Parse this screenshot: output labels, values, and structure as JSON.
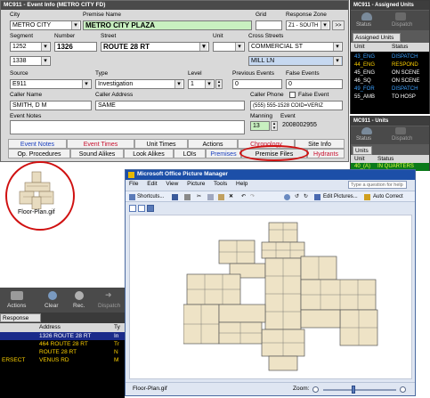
{
  "event_info": {
    "title": "MC911 - Event Info (METRO CITY FD)",
    "labels": {
      "city": "City",
      "premise_name": "Premise Name",
      "grid": "Grid",
      "response_zone": "Response Zone",
      "segment": "Segment",
      "number": "Number",
      "street": "Street",
      "unit": "Unit",
      "cross_streets": "Cross Streets",
      "source": "Source",
      "type": "Type",
      "level": "Level",
      "previous_events": "Previous Events",
      "false_events": "False Events",
      "caller_name": "Caller Name",
      "caller_address": "Caller Address",
      "caller_phone": "Caller Phone",
      "false_event": "False Event",
      "event_notes": "Event Notes",
      "manning": "Manning",
      "event": "Event"
    },
    "values": {
      "city": "METRO CITY",
      "premise_name": "METRO CITY PLAZA",
      "response_zone": "Z1 - SOUTH",
      "segment": "1252",
      "segment2": "1338",
      "number": "1326",
      "street": "ROUTE 28 RT",
      "cross_street_1": "COMMERCIAL ST",
      "cross_street_2": "MILL LN",
      "source": "E911",
      "type": "Investigation",
      "level": "1",
      "previous_events": "0",
      "false_events": "0",
      "caller_name": "SMITH, D M",
      "caller_address": "SAME",
      "caller_phone": "(555) 555-1528 COID=VERIZ",
      "manning": "13",
      "event_number": "2008002955",
      "zone_btn": ">>"
    },
    "tabs_row1": [
      "Event Notes",
      "Event Times",
      "Unit Times",
      "Actions",
      "Chronology",
      "Site Info"
    ],
    "tabs_row2": [
      "Op. Procedures",
      "Sound Alikes",
      "Look Alikes",
      "LOIs",
      "Premises",
      "Premise Files",
      "Hydrants"
    ],
    "colors": {
      "event_notes": "#1a3fbf",
      "event_times": "#c8102e",
      "chronology": "#c8102e",
      "premises": "#1a3fbf",
      "hydrants": "#c8102e"
    }
  },
  "assigned_units": {
    "title": "MC911 - Assigned Units",
    "buttons": [
      "Status",
      "Dispatch"
    ],
    "tab": "Assigned Units",
    "columns": [
      "Unit",
      "Status"
    ],
    "rows": [
      {
        "unit": "43_ENG",
        "status": "DISPATCH",
        "color": "#3aa0ff"
      },
      {
        "unit": "44_ENG",
        "status": "RESPOND",
        "color": "#ffd200"
      },
      {
        "unit": "45_ENG",
        "status": "ON SCENE",
        "color": "#ffffff"
      },
      {
        "unit": "46_SQ",
        "status": "ON SCENE",
        "color": "#ffffff"
      },
      {
        "unit": "49_FOR",
        "status": "DISPATCH",
        "color": "#3aa0ff"
      },
      {
        "unit": "55_AMB",
        "status": "TO HOSP",
        "color": "#ffffff"
      }
    ]
  },
  "units": {
    "title": "MC911 - Units",
    "buttons": [
      "Status",
      "Dispatch"
    ],
    "tab": "Units",
    "columns": [
      "Unit",
      "Status"
    ],
    "rows": [
      {
        "unit": "40_(A)",
        "status": "IN QUARTERS"
      }
    ]
  },
  "premise_file": {
    "filename": "Floor-Plan.gif"
  },
  "bottom_panel": {
    "buttons": [
      "Actions",
      "Clear",
      "Rec.",
      "Dispatch"
    ],
    "tab": "Response Opt.",
    "columns": [
      "Address",
      "Ty"
    ],
    "rows": [
      {
        "address": "1326 ROUTE 28 RT",
        "ty": "In",
        "selected": true
      },
      {
        "address": "464 ROUTE 28 RT",
        "ty": "Tr"
      },
      {
        "address": "ROUTE 28 RT",
        "ty": "N"
      },
      {
        "address": "VENUS RD",
        "ty": "M",
        "prefix": "ERSECT"
      }
    ]
  },
  "picture_manager": {
    "title": "Microsoft Office Picture Manager",
    "menu": [
      "File",
      "Edit",
      "View",
      "Picture",
      "Tools",
      "Help"
    ],
    "help_placeholder": "Type a question for help",
    "toolbar": [
      "Shortcuts...",
      "Edit Pictures...",
      "Auto Correct"
    ],
    "filename": "Floor-Plan.gif",
    "zoom_label": "Zoom:"
  }
}
